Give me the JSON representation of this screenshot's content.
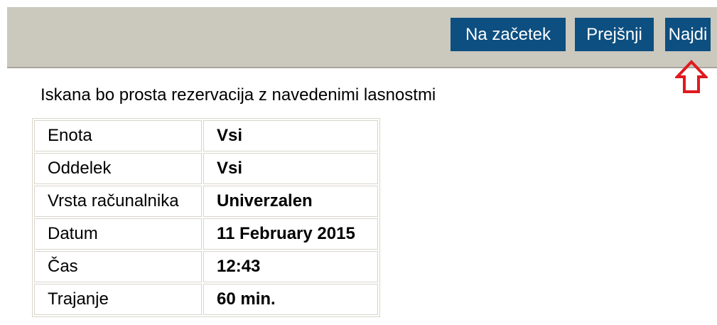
{
  "toolbar": {
    "start_label": "Na začetek",
    "prev_label": "Prejšnji",
    "find_label": "Najdi"
  },
  "colors": {
    "toolbar_bg": "#cbc8be",
    "button_bg": "#0d4f80",
    "arrow": "#e0191f"
  },
  "icons": {
    "arrow": "arrow-up-outline-icon"
  },
  "intro": "Iskana bo prosta rezervacija z navedenimi lasnostmi",
  "properties": [
    {
      "label": "Enota",
      "value": "Vsi"
    },
    {
      "label": "Oddelek",
      "value": "Vsi"
    },
    {
      "label": "Vrsta računalnika",
      "value": "Univerzalen"
    },
    {
      "label": "Datum",
      "value": "11 February 2015"
    },
    {
      "label": "Čas",
      "value": "12:43"
    },
    {
      "label": "Trajanje",
      "value": "60 min."
    }
  ]
}
